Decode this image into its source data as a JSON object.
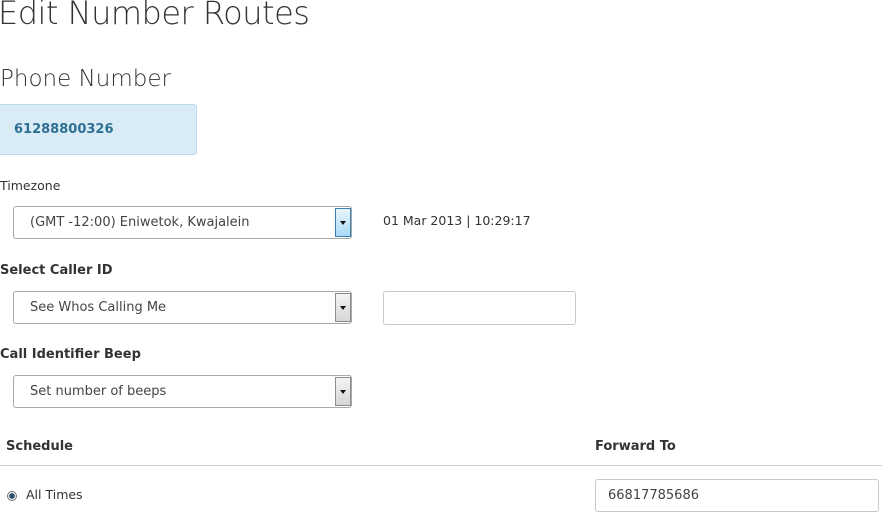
{
  "page": {
    "title": "Edit Number Routes"
  },
  "phone": {
    "section_title": "Phone Number",
    "number": "61288800326"
  },
  "timezone": {
    "label": "Timezone",
    "selected": "(GMT -12:00) Eniwetok, Kwajalein",
    "datetime": "01 Mar 2013 | 10:29:17"
  },
  "caller_id": {
    "label": "Select Caller ID",
    "selected": "See Whos Calling Me",
    "input_value": ""
  },
  "beep": {
    "label": "Call Identifier Beep",
    "selected": "Set number of beeps"
  },
  "table": {
    "col_schedule": "Schedule",
    "col_forward": "Forward To",
    "rows": [
      {
        "schedule": "All Times",
        "forward_to": "66817785686",
        "selected": true
      }
    ]
  },
  "icons": [
    "chevron-down-icon",
    "radio-icon"
  ],
  "colors": {
    "number_box_bg": "#d9ecf5",
    "number_text": "#2f6f93"
  }
}
